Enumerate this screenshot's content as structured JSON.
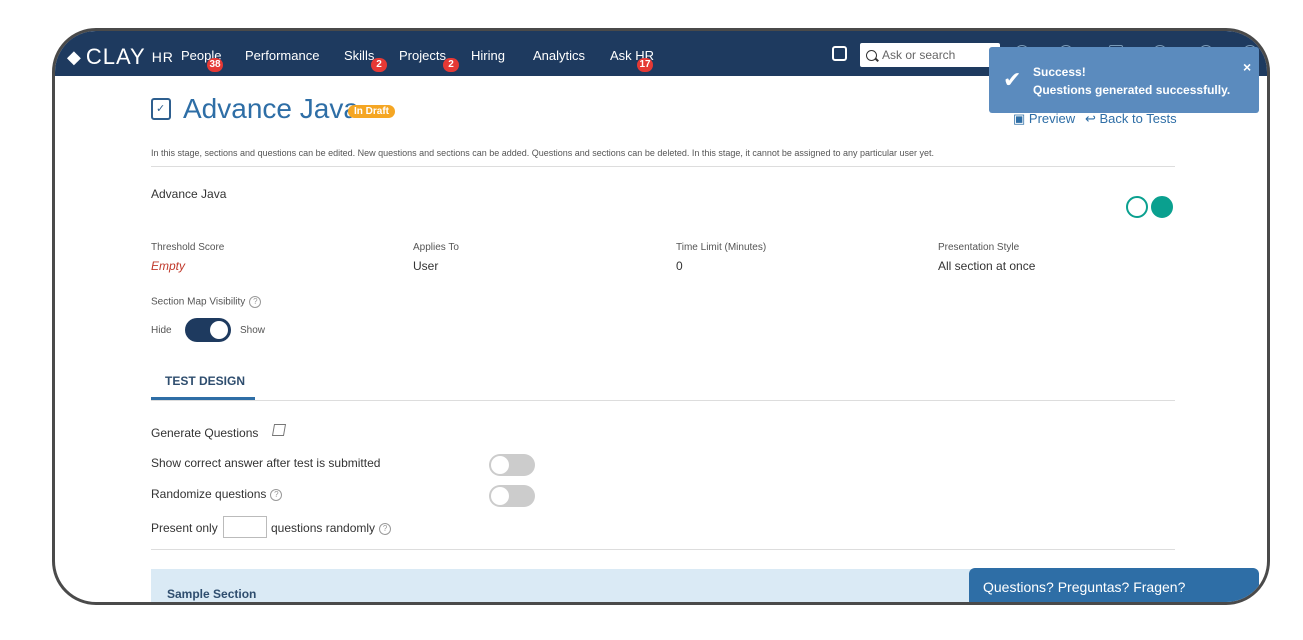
{
  "app": {
    "logo_text": "CLAY",
    "logo_suffix": "HR"
  },
  "nav": {
    "items": [
      {
        "label": "People",
        "badge": "38"
      },
      {
        "label": "Performance",
        "badge": ""
      },
      {
        "label": "Skills",
        "badge": "2"
      },
      {
        "label": "Projects",
        "badge": "2"
      },
      {
        "label": "Hiring",
        "badge": ""
      },
      {
        "label": "Analytics",
        "badge": ""
      },
      {
        "label": "Ask HR",
        "badge": "17"
      }
    ],
    "search_placeholder": "Ask or search",
    "icons": [
      "clock-icon",
      "graduation-icon",
      "bell-icon",
      "mail-icon",
      "help-icon",
      "settings-icon",
      "user-icon"
    ]
  },
  "toast": {
    "title": "Success!",
    "message": "Questions generated successfully.",
    "close": "×"
  },
  "page": {
    "title": "Advance Java",
    "status_badge": "In Draft",
    "preview_link": "Preview",
    "back_link": "Back to Tests",
    "description": "In this stage, sections and questions can be edited. New questions and sections can be added. Questions and sections can be deleted. In this stage, it cannot be assigned to any particular user yet.",
    "test_name": "Advance Java"
  },
  "fields": [
    {
      "label": "Threshold Score",
      "value": "Empty"
    },
    {
      "label": "Applies To",
      "value": "User"
    },
    {
      "label": "Time Limit (Minutes)",
      "value": "0"
    },
    {
      "label": "Presentation Style",
      "value": "All section at once"
    }
  ],
  "section_map": {
    "label": "Section Map Visibility",
    "hide": "Hide",
    "show": "Show"
  },
  "tabs": {
    "test_design": "TEST DESIGN"
  },
  "settings": {
    "generate_questions": "Generate Questions",
    "show_correct": "Show correct answer after test is submitted",
    "randomize": "Randomize questions",
    "present_only": "Present only",
    "questions_randomly": "questions randomly"
  },
  "section": {
    "title": "Sample Section"
  },
  "chat": {
    "label": "Questions? Preguntas? Fragen?"
  }
}
